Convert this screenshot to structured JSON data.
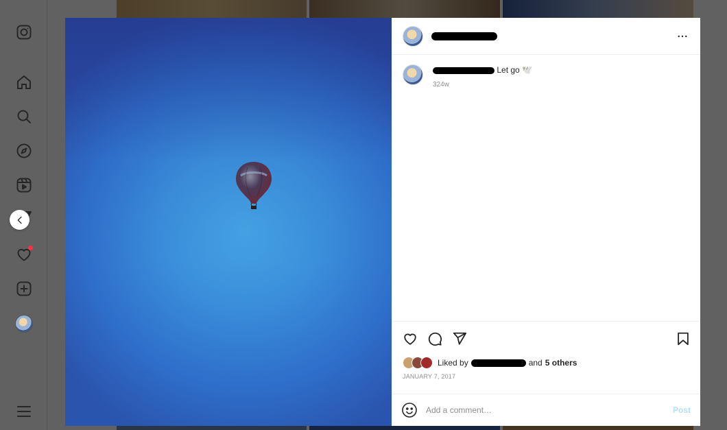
{
  "sidebar": {
    "items": [
      {
        "icon": "instagram-logo-icon"
      },
      {
        "icon": "home-icon"
      },
      {
        "icon": "search-icon"
      },
      {
        "icon": "explore-icon"
      },
      {
        "icon": "reels-icon"
      },
      {
        "icon": "messenger-icon"
      },
      {
        "icon": "heart-icon"
      },
      {
        "icon": "create-icon"
      },
      {
        "icon": "profile-avatar"
      },
      {
        "icon": "menu-icon"
      }
    ]
  },
  "post": {
    "caption_text": "Let go 🕊️",
    "caption_time": "324w",
    "likes_prefix": "Liked by",
    "likes_and": "and",
    "likes_others": "5 others",
    "date": "JANUARY 7, 2017"
  },
  "comment": {
    "placeholder": "Add a comment…",
    "post_label": "Post"
  },
  "colors": {
    "accent": "#0095f6",
    "post_disabled": "#b2dffc",
    "notification": "#ff3040"
  }
}
